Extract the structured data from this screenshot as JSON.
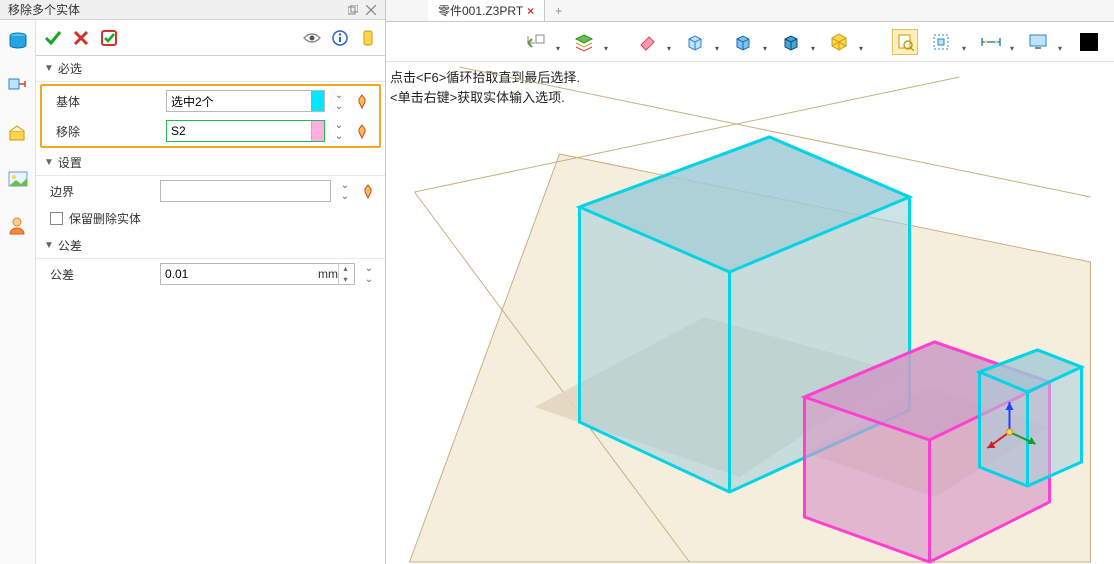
{
  "panel": {
    "title": "移除多个实体",
    "required_section": "必选",
    "settings_section": "设置",
    "tolerance_section": "公差",
    "base_label": "基体",
    "base_value": "选中2个",
    "remove_label": "移除",
    "remove_value": "S2",
    "boundary_label": "边界",
    "boundary_value": "",
    "keep_removed_label": "保留删除实体",
    "tolerance_label": "公差",
    "tolerance_value": "0.01",
    "tolerance_unit": "mm"
  },
  "tab": {
    "label": "零件001.Z3PRT"
  },
  "hint": {
    "line1": "点击<F6>循环拾取直到最后选择.",
    "line2": "<单击右键>获取实体输入选项."
  }
}
